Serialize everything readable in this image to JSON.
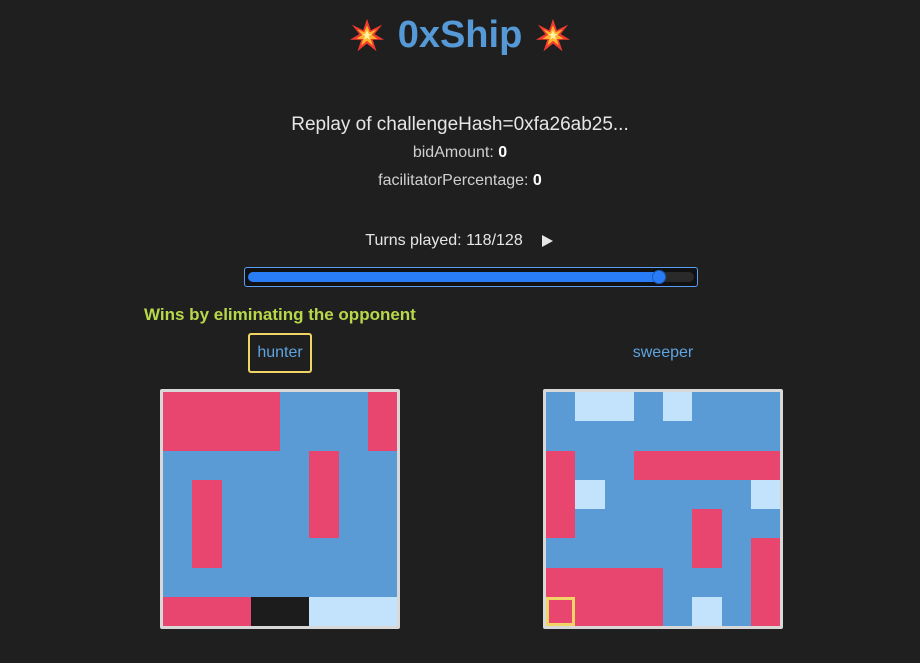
{
  "header": {
    "title": "0xShip",
    "emoji_icon": "collision-icon"
  },
  "info": {
    "replay_text": "Replay of challengeHash=0xfa26ab25...",
    "bid_label": "bidAmount:",
    "bid_value": "0",
    "facilitator_label": "facilitatorPercentage:",
    "facilitator_value": "0"
  },
  "turns": {
    "label": "Turns played: 118/128",
    "played": 118,
    "total": 128,
    "play_icon": "play-icon"
  },
  "result_text": "Wins by eliminating the opponent",
  "colors": {
    "water": "#5b9bd5",
    "ship_hit": "#e8466e",
    "miss": "#c3e2fb",
    "unknown": "#1c1c1c",
    "highlight": "#f0d466",
    "title": "#5599d6",
    "result": "#b8d84a"
  },
  "players": [
    {
      "name": "hunter",
      "active": true,
      "grid": [
        "SSSSWWWS",
        "SSSSWWWS",
        "WWWWWSWW",
        "WSWWWSWW",
        "WSWWWSWW",
        "WSWWWWWW",
        "WWWWWWWW",
        "SSSKKMMM"
      ],
      "cursor": null
    },
    {
      "name": "sweeper",
      "active": false,
      "grid": [
        "WMMWMWWW",
        "WWWWWWWW",
        "SWWSSSSS",
        "SMWWWWWM",
        "SWWWWSWW",
        "WWWWWSWS",
        "SSSSWWWS",
        "SSSSWMWS"
      ],
      "cursor": [
        7,
        0
      ]
    }
  ]
}
